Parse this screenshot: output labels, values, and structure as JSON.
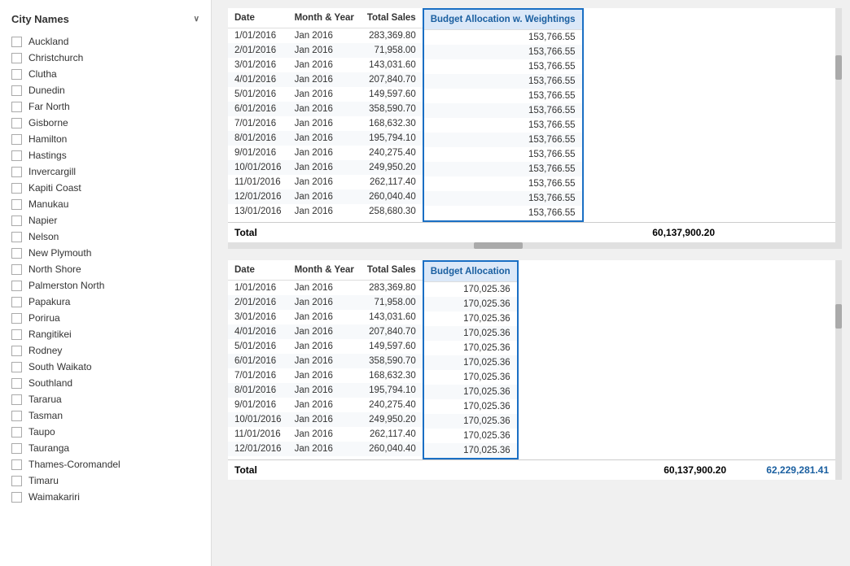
{
  "sidebar": {
    "title": "City Names",
    "chevron": "∨",
    "cities": [
      "Auckland",
      "Christchurch",
      "Clutha",
      "Dunedin",
      "Far North",
      "Gisborne",
      "Hamilton",
      "Hastings",
      "Invercargill",
      "Kapiti Coast",
      "Manukau",
      "Napier",
      "Nelson",
      "New Plymouth",
      "North Shore",
      "Palmerston North",
      "Papakura",
      "Porirua",
      "Rangitikei",
      "Rodney",
      "South Waikato",
      "Southland",
      "Tararua",
      "Tasman",
      "Taupo",
      "Tauranga",
      "Thames-Coromandel",
      "Timaru",
      "Waimakariri"
    ]
  },
  "top_table": {
    "columns": [
      "Date",
      "Month & Year",
      "Total Sales",
      "Budget Allocation w. Weightings"
    ],
    "rows": [
      [
        "1/01/2016",
        "Jan 2016",
        "283,369.80",
        "153,766.55"
      ],
      [
        "2/01/2016",
        "Jan 2016",
        "71,958.00",
        "153,766.55"
      ],
      [
        "3/01/2016",
        "Jan 2016",
        "143,031.60",
        "153,766.55"
      ],
      [
        "4/01/2016",
        "Jan 2016",
        "207,840.70",
        "153,766.55"
      ],
      [
        "5/01/2016",
        "Jan 2016",
        "149,597.60",
        "153,766.55"
      ],
      [
        "6/01/2016",
        "Jan 2016",
        "358,590.70",
        "153,766.55"
      ],
      [
        "7/01/2016",
        "Jan 2016",
        "168,632.30",
        "153,766.55"
      ],
      [
        "8/01/2016",
        "Jan 2016",
        "195,794.10",
        "153,766.55"
      ],
      [
        "9/01/2016",
        "Jan 2016",
        "240,275.40",
        "153,766.55"
      ],
      [
        "10/01/2016",
        "Jan 2016",
        "249,950.20",
        "153,766.55"
      ],
      [
        "11/01/2016",
        "Jan 2016",
        "262,117.40",
        "153,766.55"
      ],
      [
        "12/01/2016",
        "Jan 2016",
        "260,040.40",
        "153,766.55"
      ],
      [
        "13/01/2016",
        "Jan 2016",
        "258,680.30",
        "153,766.55"
      ]
    ],
    "total_label": "Total",
    "total_sales": "60,137,900.20",
    "total_budget": ""
  },
  "bottom_table": {
    "columns": [
      "Date",
      "Month & Year",
      "Total Sales",
      "Budget Allocation"
    ],
    "rows": [
      [
        "1/01/2016",
        "Jan 2016",
        "283,369.80",
        "170,025.36"
      ],
      [
        "2/01/2016",
        "Jan 2016",
        "71,958.00",
        "170,025.36"
      ],
      [
        "3/01/2016",
        "Jan 2016",
        "143,031.60",
        "170,025.36"
      ],
      [
        "4/01/2016",
        "Jan 2016",
        "207,840.70",
        "170,025.36"
      ],
      [
        "5/01/2016",
        "Jan 2016",
        "149,597.60",
        "170,025.36"
      ],
      [
        "6/01/2016",
        "Jan 2016",
        "358,590.70",
        "170,025.36"
      ],
      [
        "7/01/2016",
        "Jan 2016",
        "168,632.30",
        "170,025.36"
      ],
      [
        "8/01/2016",
        "Jan 2016",
        "195,794.10",
        "170,025.36"
      ],
      [
        "9/01/2016",
        "Jan 2016",
        "240,275.40",
        "170,025.36"
      ],
      [
        "10/01/2016",
        "Jan 2016",
        "249,950.20",
        "170,025.36"
      ],
      [
        "11/01/2016",
        "Jan 2016",
        "262,117.40",
        "170,025.36"
      ],
      [
        "12/01/2016",
        "Jan 2016",
        "260,040.40",
        "170,025.36"
      ]
    ],
    "total_label": "Total",
    "total_sales": "60,137,900.20",
    "total_budget": "62,229,281.41"
  }
}
